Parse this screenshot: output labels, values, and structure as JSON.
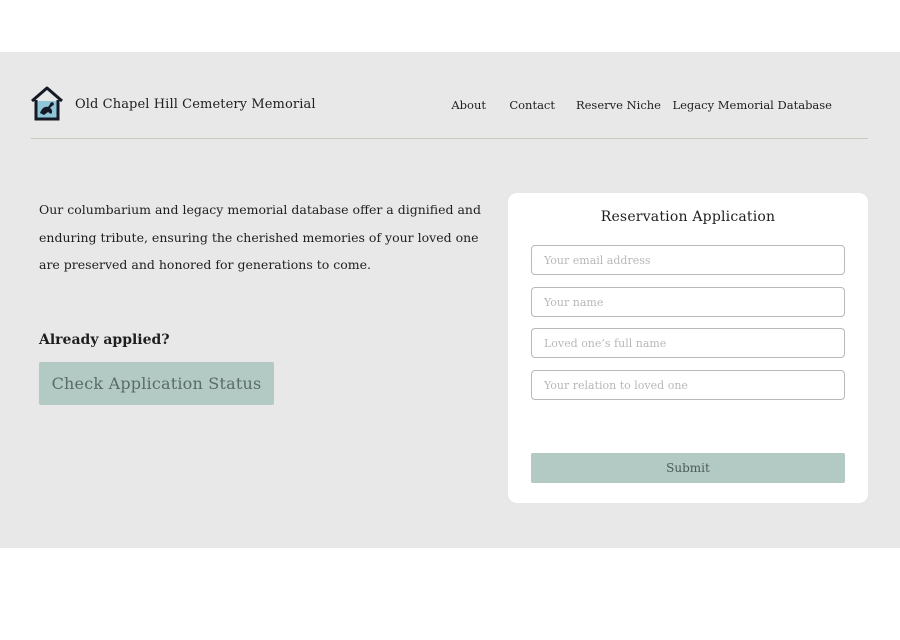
{
  "header": {
    "title": "Old Chapel Hill Cemetery Memorial",
    "logo_icon": "house-bird-icon",
    "nav": [
      {
        "label": "About"
      },
      {
        "label": "Contact"
      },
      {
        "label": "Reserve Niche"
      },
      {
        "label": "Legacy Memorial Database"
      }
    ]
  },
  "main": {
    "intro": "Our columbarium and legacy memorial database offer a dignified and enduring tribute, ensuring the cherished memories of your loved one are preserved and honored for generations to come.",
    "already_applied": "Already applied?",
    "status_button": "Check Application Status"
  },
  "form": {
    "title": "Reservation Application",
    "fields": [
      {
        "placeholder": "Your email address",
        "value": ""
      },
      {
        "placeholder": "Your name",
        "value": ""
      },
      {
        "placeholder": "Loved one’s full name",
        "value": ""
      },
      {
        "placeholder": "Your relation to loved one",
        "value": ""
      }
    ],
    "submit": "Submit"
  },
  "colors": {
    "band": "#e8e8e8",
    "accent": "#b3c9c3",
    "card": "#ffffff",
    "rule": "#c9c9bd"
  }
}
